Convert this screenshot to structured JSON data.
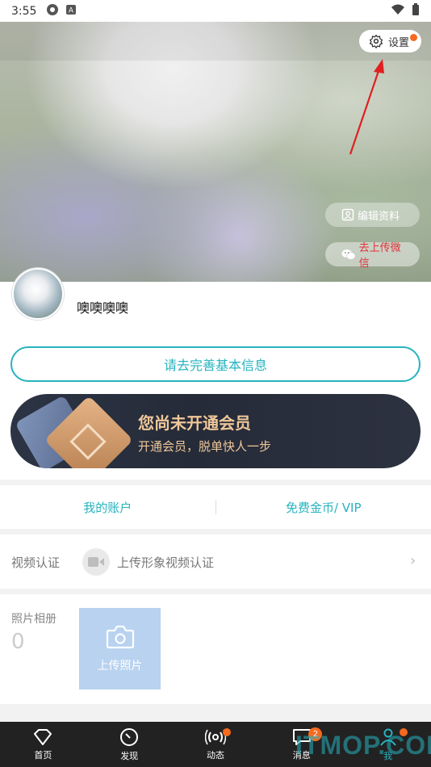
{
  "status_bar": {
    "time": "3:55"
  },
  "hero": {
    "settings_label": "设置",
    "edit_profile_label": "编辑资料",
    "wechat_label": "去上传微信"
  },
  "profile": {
    "username": "噢噢噢噢",
    "complete_info_label": "请去完善基本信息",
    "vip_title": "您尚未开通会员",
    "vip_subtitle": "开通会员，脱单快人一步"
  },
  "account": {
    "my_account_label": "我的账户",
    "free_coins_label": "免费金币/ VIP"
  },
  "video_verify": {
    "label": "视频认证",
    "text": "上传形象视频认证"
  },
  "album": {
    "label": "照片相册",
    "count": "0",
    "upload_label": "上传照片"
  },
  "bottom_nav": {
    "items": [
      {
        "label": "首页",
        "icon": "heart-icon"
      },
      {
        "label": "发现",
        "icon": "compass-icon"
      },
      {
        "label": "动态",
        "icon": "broadcast-icon"
      },
      {
        "label": "消息",
        "icon": "chat-icon",
        "badge": "2"
      },
      {
        "label": "我",
        "icon": "person-icon"
      }
    ]
  },
  "watermark": "ITMOP.COM",
  "colors": {
    "accent": "#27b3bf",
    "badge": "#f56a1e",
    "vip_gold": "#f0c79a"
  }
}
